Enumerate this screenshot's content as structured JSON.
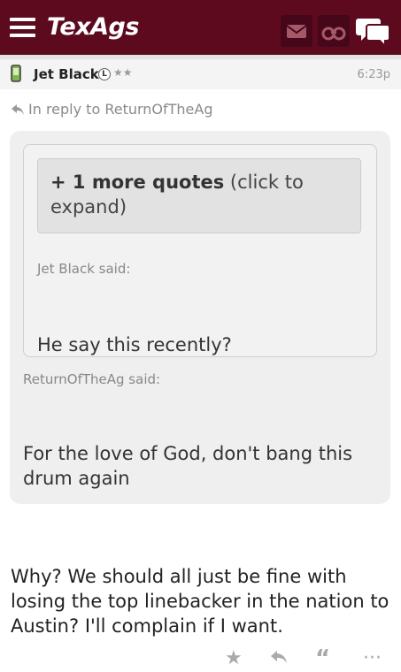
{
  "header": {
    "logo": "TexAgs",
    "icons": [
      "menu-icon",
      "mail-icon",
      "binoculars-icon",
      "chat-icon"
    ],
    "color": "#5d0a1f"
  },
  "post": {
    "author": "Jet Black",
    "badge": "L",
    "stars": "★★",
    "time": "6:23p",
    "reply_to": "In reply to ReturnOfTheAg",
    "more_quotes_bold": "+ 1 more quotes",
    "more_quotes_rest": " (click to expand)",
    "quote1_said": "Jet Black said:",
    "quote1_text": "He say this recently?",
    "quote2_said": "ReturnOfTheAg said:",
    "quote2_text": "For the love of God, don't bang this drum again",
    "body": "Why? We should all just be fine with losing the top linebacker in the nation to Austin? I'll complain if I want."
  },
  "footer": {
    "icons": [
      "star-icon",
      "reply-icon",
      "quote-icon",
      "more-icon"
    ]
  }
}
